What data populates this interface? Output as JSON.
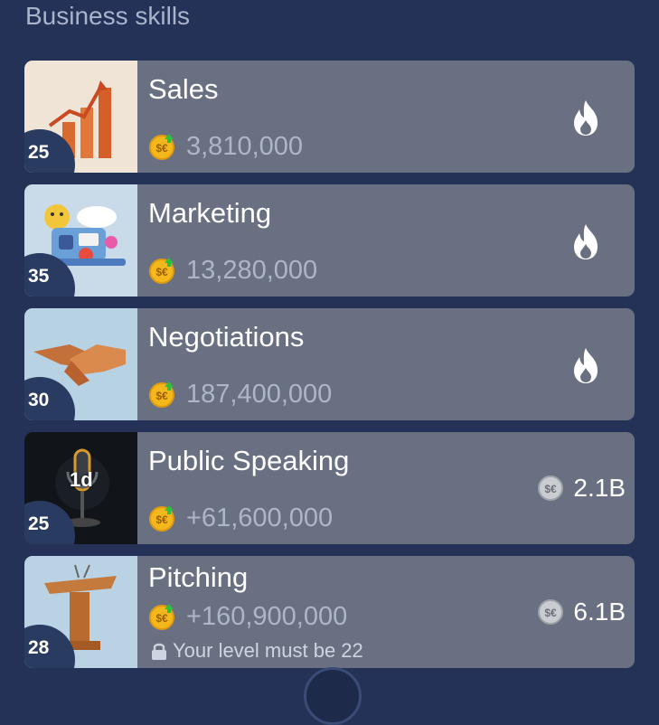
{
  "section": {
    "title": "Business skills"
  },
  "skills": [
    {
      "name": "Sales",
      "level": "25",
      "income": "3,810,000",
      "status": "hot"
    },
    {
      "name": "Marketing",
      "level": "35",
      "income": "13,280,000",
      "status": "hot"
    },
    {
      "name": "Negotiations",
      "level": "30",
      "income": "187,400,000",
      "status": "hot"
    },
    {
      "name": "Public Speaking",
      "level": "25",
      "income": "+61,600,000",
      "cooldown": "1d",
      "price": "2.1B",
      "status": "available"
    },
    {
      "name": "Pitching",
      "level": "28",
      "income": "+160,900,000",
      "price": "6.1B",
      "locked_text": "Your level must be 22",
      "status": "locked"
    }
  ],
  "colors": {
    "background": "#233256",
    "card": "#687082",
    "income_text": "#aeb6c6",
    "coin_gold": "#f5b81c"
  },
  "icons": {
    "hot": "fire-icon",
    "coin": "coin-icon",
    "price": "silver-coin-icon",
    "lock": "lock-icon"
  }
}
